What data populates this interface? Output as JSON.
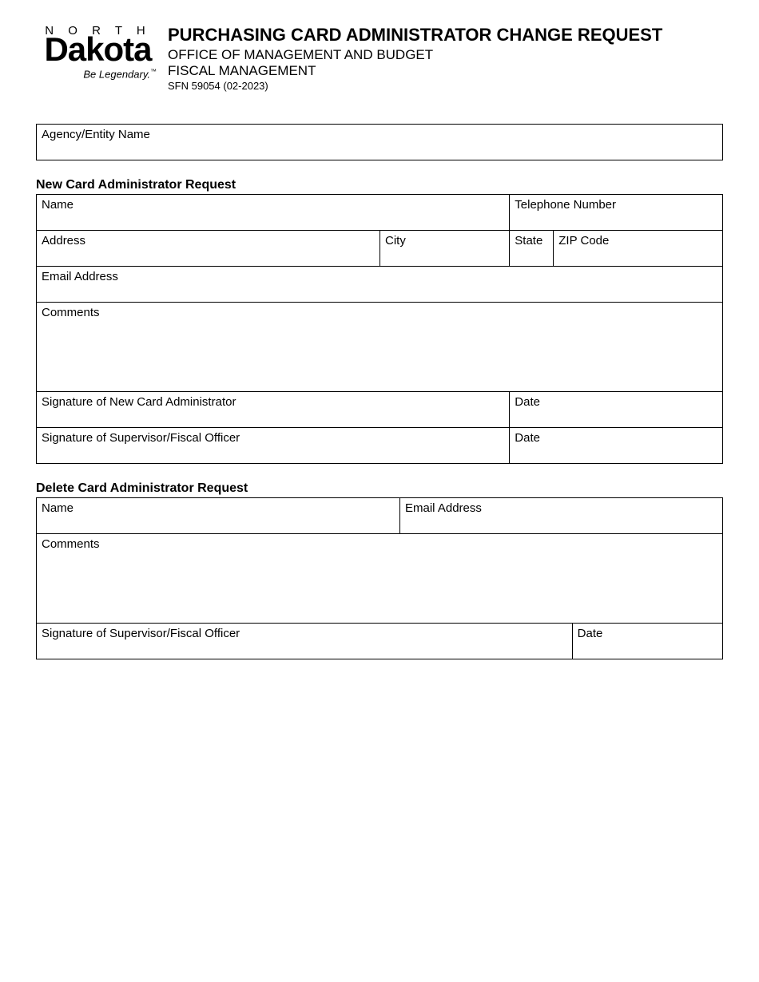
{
  "logo": {
    "top": "N O R T H",
    "main": "Dakota",
    "tag": "Be Legendary.",
    "tm": "™"
  },
  "header": {
    "title": "PURCHASING CARD ADMINISTRATOR CHANGE REQUEST",
    "dept1": "OFFICE OF MANAGEMENT AND BUDGET",
    "dept2": "FISCAL MANAGEMENT",
    "sfn": "SFN 59054 (02-2023)"
  },
  "fields": {
    "agency": "Agency/Entity Name",
    "newSection": "New Card Administrator Request",
    "name": "Name",
    "telephone": "Telephone Number",
    "address": "Address",
    "city": "City",
    "state": "State",
    "zip": "ZIP Code",
    "email": "Email Address",
    "comments": "Comments",
    "sigNewAdmin": "Signature of New Card Administrator",
    "date": "Date",
    "sigSupervisor": "Signature of Supervisor/Fiscal Officer",
    "deleteSection": "Delete Card Administrator Request"
  }
}
